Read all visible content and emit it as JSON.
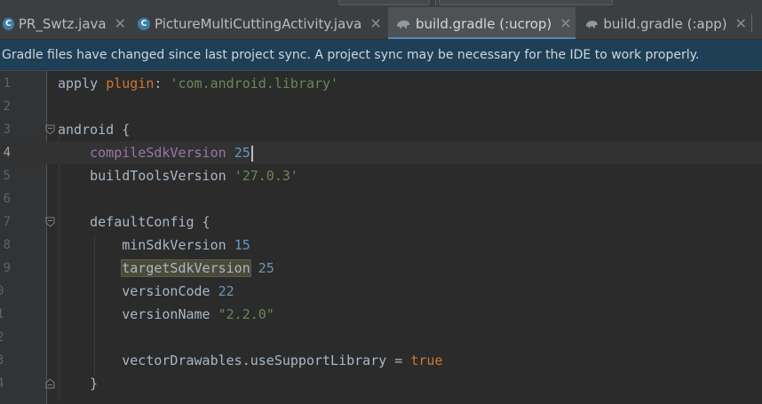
{
  "tabs": [
    {
      "label": "PR_Swtz.java",
      "icon": "java-class-icon",
      "active": false
    },
    {
      "label": "PictureMultiCuttingActivity.java",
      "icon": "java-class-icon",
      "active": false
    },
    {
      "label": "build.gradle (:ucrop)",
      "icon": "gradle-elephant-icon",
      "active": true
    },
    {
      "label": "build.gradle (:app)",
      "icon": "gradle-elephant-icon",
      "active": false
    }
  ],
  "tab_close_glyph": "✕",
  "banner": {
    "message": "Gradle files have changed since last project sync. A project sync may be necessary for the IDE to work properly."
  },
  "editor": {
    "current_line": 4,
    "lines": [
      {
        "number": "1",
        "indent": "",
        "tokens": [
          {
            "t": "apply ",
            "c": ""
          },
          {
            "t": "plugin",
            "c": "kw"
          },
          {
            "t": ": ",
            "c": ""
          },
          {
            "t": "'com.android.library'",
            "c": "str"
          }
        ]
      },
      {
        "number": "2",
        "indent": "",
        "tokens": []
      },
      {
        "number": "3",
        "indent": "",
        "tokens": [
          {
            "t": "android {",
            "c": ""
          }
        ]
      },
      {
        "number": "4",
        "indent": "    ",
        "tokens": [
          {
            "t": "compileSdkVersion",
            "c": "prop"
          },
          {
            "t": " ",
            "c": ""
          },
          {
            "t": "25",
            "c": "num"
          }
        ]
      },
      {
        "number": "5",
        "indent": "    ",
        "tokens": [
          {
            "t": "buildToolsVersion ",
            "c": ""
          },
          {
            "t": "'27.0.3'",
            "c": "str"
          }
        ]
      },
      {
        "number": "6",
        "indent": "",
        "tokens": []
      },
      {
        "number": "7",
        "indent": "    ",
        "tokens": [
          {
            "t": "defaultConfig {",
            "c": ""
          }
        ]
      },
      {
        "number": "8",
        "indent": "        ",
        "tokens": [
          {
            "t": "minSdkVersion ",
            "c": ""
          },
          {
            "t": "15",
            "c": "num"
          }
        ]
      },
      {
        "number": "9",
        "indent": "        ",
        "tokens": [
          {
            "t": "targetSdkVersion",
            "c": "sel"
          },
          {
            "t": " ",
            "c": ""
          },
          {
            "t": "25",
            "c": "num"
          }
        ]
      },
      {
        "number": "0",
        "indent": "        ",
        "tokens": [
          {
            "t": "versionCode ",
            "c": ""
          },
          {
            "t": "22",
            "c": "num"
          }
        ]
      },
      {
        "number": "1",
        "indent": "        ",
        "tokens": [
          {
            "t": "versionName ",
            "c": ""
          },
          {
            "t": "\"2.2.0\"",
            "c": "str"
          }
        ]
      },
      {
        "number": "2",
        "indent": "",
        "tokens": []
      },
      {
        "number": "3",
        "indent": "        ",
        "tokens": [
          {
            "t": "vectorDrawables.useSupportLibrary = ",
            "c": ""
          },
          {
            "t": "true",
            "c": "kw"
          }
        ]
      },
      {
        "number": "4",
        "indent": "    ",
        "tokens": [
          {
            "t": "}",
            "c": ""
          }
        ]
      },
      {
        "number": "",
        "indent": "",
        "tokens": []
      }
    ]
  },
  "colors": {
    "accent": "#4a88c7",
    "banner_bg": "#1f3f56",
    "editor_bg": "#2b2b2b",
    "keyword": "#cc7832",
    "string": "#6a8759",
    "number": "#6897bb",
    "property": "#9876aa"
  }
}
